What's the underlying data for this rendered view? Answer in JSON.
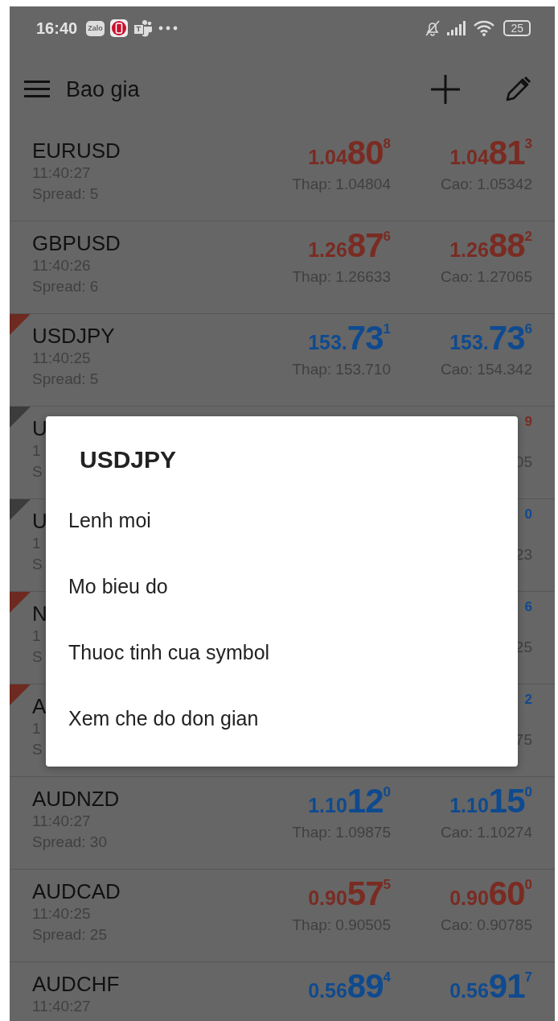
{
  "status_bar": {
    "time": "16:40",
    "app_icons": [
      {
        "kind": "chat",
        "label": "Zalo"
      },
      {
        "kind": "phone"
      },
      {
        "kind": "team",
        "label": "T"
      }
    ],
    "battery": "25"
  },
  "toolbar": {
    "title": "Bao gia"
  },
  "quotes": [
    {
      "symbol": "EURUSD",
      "time": "11:40:27",
      "spread": "Spread: 5",
      "bid": {
        "color": "#7a2b22",
        "prefix": "1.04",
        "big": "80",
        "sup": "8"
      },
      "ask": {
        "color": "#7a2b22",
        "prefix": "1.04",
        "big": "81",
        "sup": "3"
      },
      "low": "Thap: 1.04804",
      "high": "Cao: 1.05342"
    },
    {
      "symbol": "GBPUSD",
      "time": "11:40:26",
      "spread": "Spread: 6",
      "bid": {
        "color": "#7a2b22",
        "prefix": "1.26",
        "big": "87",
        "sup": "6"
      },
      "ask": {
        "color": "#7a2b22",
        "prefix": "1.26",
        "big": "88",
        "sup": "2"
      },
      "low": "Thap: 1.26633",
      "high": "Cao: 1.27065"
    },
    {
      "symbol": "USDJPY",
      "time": "11:40:25",
      "spread": "Spread: 5",
      "color": "#6e2a20",
      "bid": {
        "color": "#0f4a8f",
        "prefix": "153.",
        "big": "73",
        "sup": "1"
      },
      "ask": {
        "color": "#0f4a8f",
        "prefix": "153.",
        "big": "73",
        "sup": "6"
      },
      "low": "Thap: 153.710",
      "high": "Cao: 154.342"
    },
    {
      "symbol": "U",
      "time": "1",
      "spread": "S",
      "color": "#3c3c3c",
      "ask": {
        "color": "#7a2b22",
        "sup": "9"
      },
      "high": "05"
    },
    {
      "symbol": "U",
      "time": "1",
      "spread": "S",
      "color": "#3c3c3c",
      "ask": {
        "color": "#0f4a8f",
        "sup": "0"
      },
      "high": "23"
    },
    {
      "symbol": "N",
      "time": "1",
      "spread": "S",
      "color": "#6e2a20",
      "ask": {
        "color": "#0f4a8f",
        "sup": "6"
      },
      "high": "25"
    },
    {
      "symbol": "A",
      "time": "1",
      "spread": "S",
      "color": "#6e2a20",
      "ask": {
        "color": "#0f4a8f",
        "sup": "2"
      },
      "high": "75"
    },
    {
      "symbol": "AUDNZD",
      "time": "11:40:27",
      "spread": "Spread: 30",
      "bid": {
        "color": "#0f4a8f",
        "prefix": "1.10",
        "big": "12",
        "sup": "0"
      },
      "ask": {
        "color": "#0f4a8f",
        "prefix": "1.10",
        "big": "15",
        "sup": "0"
      },
      "low": "Thap: 1.09875",
      "high": "Cao: 1.10274"
    },
    {
      "symbol": "AUDCAD",
      "time": "11:40:25",
      "spread": "Spread: 25",
      "bid": {
        "color": "#7a2b22",
        "prefix": "0.90",
        "big": "57",
        "sup": "5"
      },
      "ask": {
        "color": "#7a2b22",
        "prefix": "0.90",
        "big": "60",
        "sup": "0"
      },
      "low": "Thap: 0.90505",
      "high": "Cao: 0.90785"
    },
    {
      "symbol": "AUDCHF",
      "time": "11:40:27",
      "bid": {
        "color": "#0f4a8f",
        "prefix": "0.56",
        "big": "89",
        "sup": "4"
      },
      "ask": {
        "color": "#0f4a8f",
        "prefix": "0.56",
        "big": "91",
        "sup": "7"
      }
    }
  ],
  "dialog": {
    "title": "USDJPY",
    "items": [
      "Lenh moi",
      "Mo bieu do",
      "Thuoc tinh cua symbol",
      "Xem che do don gian"
    ]
  }
}
